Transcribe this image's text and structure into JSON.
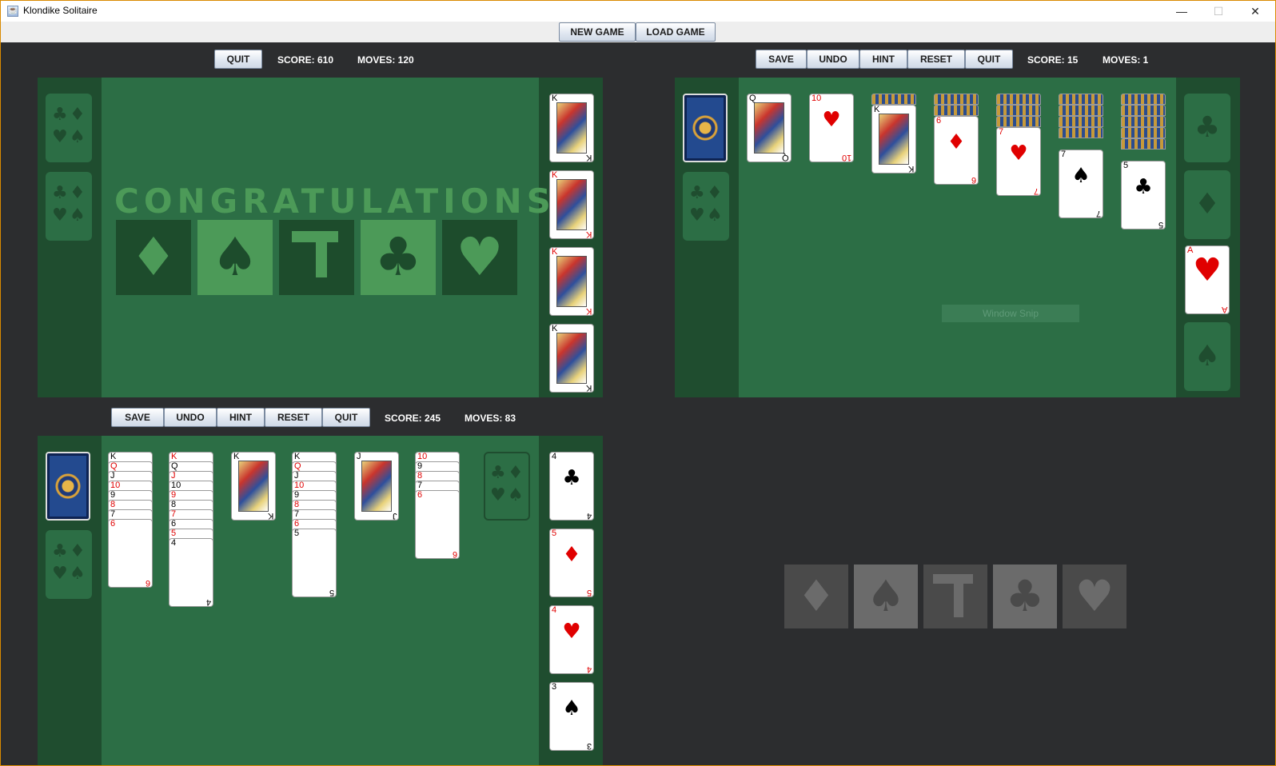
{
  "window": {
    "title": "Klondike Solitaire",
    "minimize": "—",
    "maximize": "☐",
    "close": "✕"
  },
  "topbar": {
    "new_game": "NEW GAME",
    "load_game": "LOAD GAME"
  },
  "game1": {
    "buttons": {
      "quit": "QUIT"
    },
    "score": "SCORE: 610",
    "moves": "MOVES: 120",
    "congrats": "CONGRATULATIONS!",
    "tiles": [
      "♦",
      "♠",
      "T",
      "♣",
      "♥"
    ],
    "kings": [
      {
        "rank": "K",
        "suit": "♣",
        "color": "black"
      },
      {
        "rank": "K",
        "suit": "♦",
        "color": "red"
      },
      {
        "rank": "K",
        "suit": "♥",
        "color": "red"
      },
      {
        "rank": "K",
        "suit": "♠",
        "color": "black"
      }
    ]
  },
  "game2": {
    "buttons": {
      "save": "SAVE",
      "undo": "UNDO",
      "hint": "HINT",
      "reset": "RESET",
      "quit": "QUIT"
    },
    "score": "SCORE: 15",
    "moves": "MOVES: 1",
    "waste": {
      "rank": "Q",
      "suit": "♠",
      "color": "black"
    },
    "tableau_tops": [
      {
        "rank": "10",
        "suit": "♥",
        "color": "red"
      },
      {
        "rank": "K",
        "suit": "♣",
        "color": "black"
      },
      {
        "rank": "6",
        "suit": "♦",
        "color": "red"
      },
      {
        "rank": "7",
        "suit": "♥",
        "color": "red"
      },
      {
        "rank": "7",
        "suit": "♠",
        "color": "black"
      },
      {
        "rank": "5",
        "suit": "♣",
        "color": "black"
      }
    ],
    "foundations": [
      "♣",
      "♦",
      "A ♥",
      "♠"
    ],
    "foundation_ace": {
      "rank": "A",
      "suit": "♥",
      "color": "red"
    },
    "snip": "Window Snip"
  },
  "game3": {
    "buttons": {
      "save": "SAVE",
      "undo": "UNDO",
      "hint": "HINT",
      "reset": "RESET",
      "quit": "QUIT"
    },
    "score": "SCORE: 245",
    "moves": "MOVES: 83",
    "columns": [
      [
        "K",
        "Q",
        "J",
        "10",
        "9",
        "8",
        "7",
        "6"
      ],
      [
        "K",
        "Q",
        "J",
        "10",
        "9",
        "8",
        "7",
        "6",
        "5",
        "4"
      ],
      [
        "K"
      ],
      [
        "K",
        "Q",
        "J",
        "10",
        "9",
        "8",
        "7",
        "6",
        "5"
      ],
      [
        "J"
      ],
      [
        "10",
        "9",
        "8",
        "7",
        "6"
      ]
    ],
    "right_cards": [
      {
        "rank": "4",
        "suit": "♣",
        "color": "black"
      },
      {
        "rank": "5",
        "suit": "♦",
        "color": "red"
      },
      {
        "rank": "4",
        "suit": "♥",
        "color": "red"
      },
      {
        "rank": "3",
        "suit": "♠",
        "color": "black"
      }
    ]
  },
  "game4_logo": [
    "♦",
    "♠",
    "T",
    "♣",
    "♥"
  ]
}
